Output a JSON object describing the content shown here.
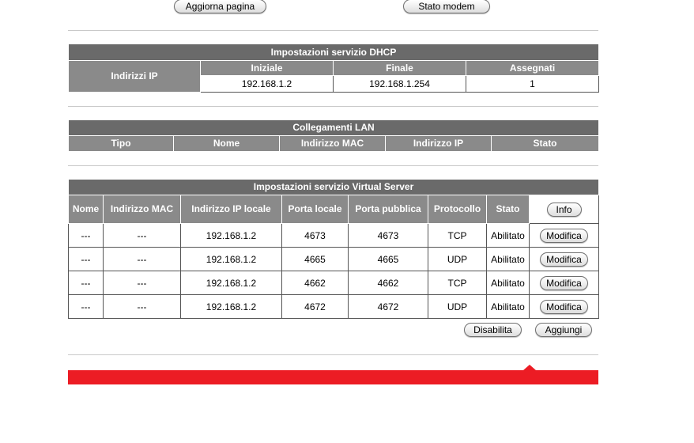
{
  "top_buttons": {
    "refresh": "Aggiorna pagina",
    "modem_status": "Stato modem"
  },
  "dhcp": {
    "title": "Impostazioni servizio DHCP",
    "row_label": "Indirizzi IP",
    "headers": [
      "Iniziale",
      "Finale",
      "Assegnati"
    ],
    "values": [
      "192.168.1.2",
      "192.168.1.254",
      "1"
    ]
  },
  "lan": {
    "title": "Collegamenti LAN",
    "headers": [
      "Tipo",
      "Nome",
      "Indirizzo MAC",
      "Indirizzo IP",
      "Stato"
    ]
  },
  "vs": {
    "title": "Impostazioni servizio Virtual Server",
    "headers": {
      "name": "Nome",
      "mac": "Indirizzo MAC",
      "ip": "Indirizzo IP locale",
      "local_port": "Porta locale",
      "public_port": "Porta pubblica",
      "protocol": "Protocollo",
      "status": "Stato"
    },
    "info_button": "Info",
    "edit_button": "Modifica",
    "rows": [
      [
        "---",
        "---",
        "192.168.1.2",
        "4673",
        "4673",
        "TCP",
        "Abilitato"
      ],
      [
        "---",
        "---",
        "192.168.1.2",
        "4665",
        "4665",
        "UDP",
        "Abilitato"
      ],
      [
        "---",
        "---",
        "192.168.1.2",
        "4662",
        "4662",
        "TCP",
        "Abilitato"
      ],
      [
        "---",
        "---",
        "192.168.1.2",
        "4672",
        "4672",
        "UDP",
        "Abilitato"
      ]
    ],
    "disable_button": "Disabilita",
    "add_button": "Aggiungi"
  },
  "colors": {
    "header_gray": "#8a8a8a",
    "title_gray": "#6a6a6a",
    "red_bar": "#ec1c24"
  }
}
